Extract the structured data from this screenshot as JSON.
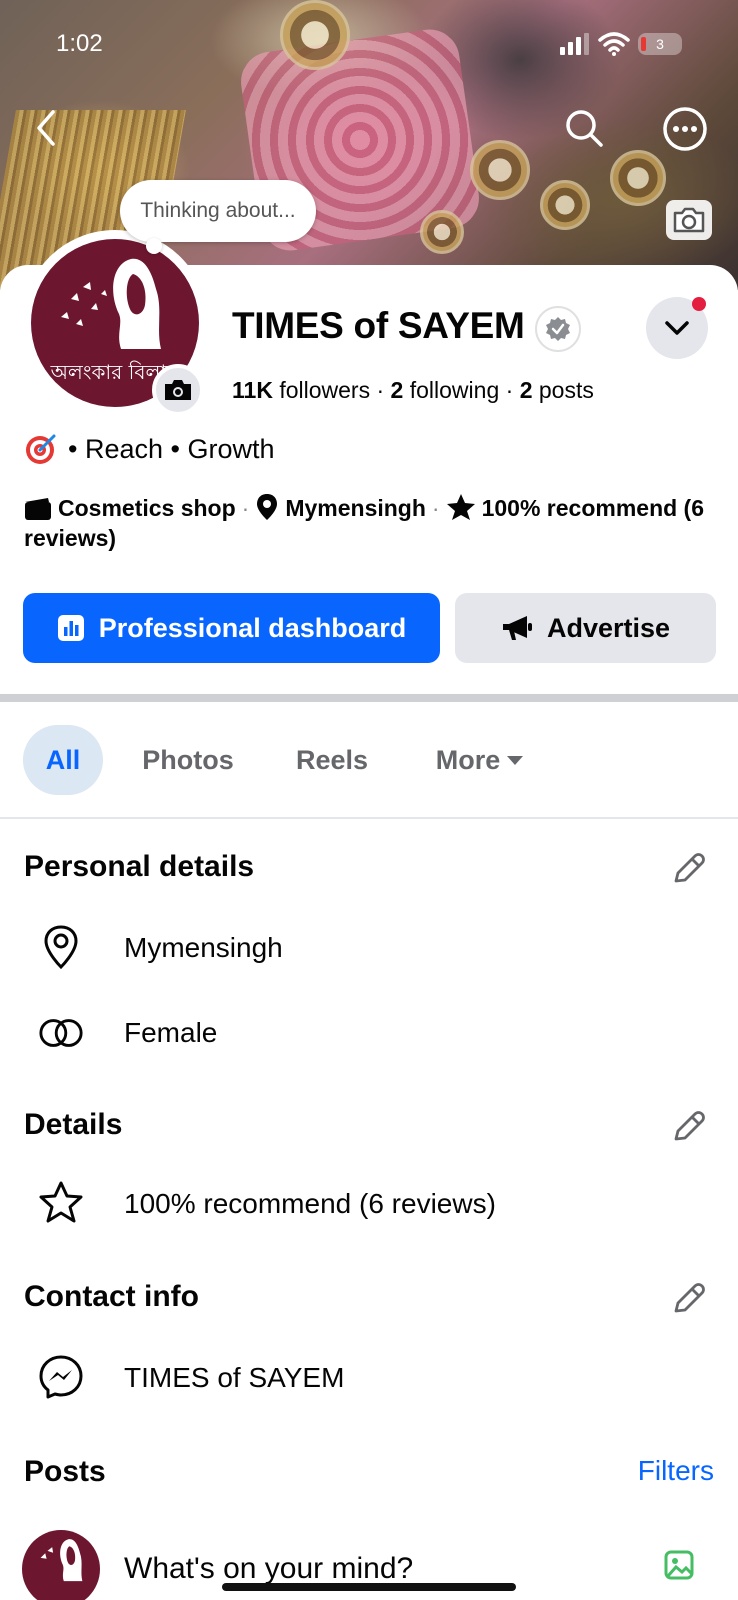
{
  "status_bar": {
    "time": "1:02",
    "battery": "3"
  },
  "bubble": {
    "text": "Thinking about..."
  },
  "profile": {
    "name": "TIMES of SAYEM",
    "avatar_text": "অলংকার বিলাস",
    "followers_count": "11K",
    "followers_label": "followers",
    "following_count": "2",
    "following_label": "following",
    "posts_count": "2",
    "posts_label": "posts",
    "bio": "• Reach • Growth",
    "category": "Cosmetics shop",
    "location": "Mymensingh",
    "recommend": "100% recommend (6 reviews)"
  },
  "actions": {
    "dashboard_label": "Professional dashboard",
    "advertise_label": "Advertise"
  },
  "tabs": [
    {
      "label": "All"
    },
    {
      "label": "Photos"
    },
    {
      "label": "Reels"
    },
    {
      "label": "More"
    }
  ],
  "personal_details": {
    "title": "Personal details",
    "location": "Mymensingh",
    "gender": "Female"
  },
  "details": {
    "title": "Details",
    "recommend": "100% recommend (6 reviews)"
  },
  "contact": {
    "title": "Contact info",
    "messenger": "TIMES of SAYEM"
  },
  "posts": {
    "title": "Posts",
    "filters_label": "Filters",
    "composer_placeholder": "What's on your mind?"
  },
  "colors": {
    "accent": "#0866ff",
    "avatar_bg": "#6d1630",
    "notification_dot": "#e41e3f"
  }
}
